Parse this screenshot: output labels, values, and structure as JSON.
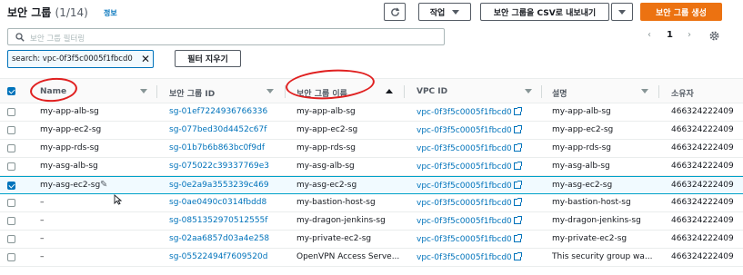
{
  "header": {
    "title": "보안 그룹",
    "count": "(1/14)",
    "info": "정보",
    "actions_label": "작업",
    "export_label": "보안 그룹을 CSV로 내보내기",
    "create_label": "보안 그룹 생성"
  },
  "search": {
    "placeholder": "보안 그룹 필터링"
  },
  "pagination": {
    "current_page": "1"
  },
  "filter": {
    "token": "search: vpc-0f3f5c0005f1fbcd0",
    "clear_label": "필터 지우기"
  },
  "table": {
    "headers": [
      "Name",
      "보안 그룹 ID",
      "보안 그룹 이름",
      "VPC ID",
      "설명",
      "소유자"
    ],
    "sorted_column": "보안 그룹 이름",
    "rows": [
      {
        "name": "my-app-alb-sg",
        "id": "sg-01ef7224936766336",
        "group_name": "my-app-alb-sg",
        "vpc": "vpc-0f3f5c0005f1fbcd0",
        "desc": "my-app-alb-sg",
        "owner": "466324222409",
        "selected": false
      },
      {
        "name": "my-app-ec2-sg",
        "id": "sg-077bed30d4452c67f",
        "group_name": "my-app-ec2-sg",
        "vpc": "vpc-0f3f5c0005f1fbcd0",
        "desc": "my-app-ec2-sg",
        "owner": "466324222409",
        "selected": false
      },
      {
        "name": "my-app-rds-sg",
        "id": "sg-01b7b6b863bc0f9df",
        "group_name": "my-app-rds-sg",
        "vpc": "vpc-0f3f5c0005f1fbcd0",
        "desc": "my-app-rds-sg",
        "owner": "466324222409",
        "selected": false
      },
      {
        "name": "my-asg-alb-sg",
        "id": "sg-075022c39337769e3",
        "group_name": "my-asg-alb-sg",
        "vpc": "vpc-0f3f5c0005f1fbcd0",
        "desc": "my-asg-alb-sg",
        "owner": "466324222409",
        "selected": false
      },
      {
        "name": "my-asg-ec2-sg",
        "id": "sg-0e2a9a3553239c469",
        "group_name": "my-asg-ec2-sg",
        "vpc": "vpc-0f3f5c0005f1fbcd0",
        "desc": "my-asg-ec2-sg",
        "owner": "466324222409",
        "selected": true
      },
      {
        "name": "–",
        "id": "sg-0ae0490c0314fbdd8",
        "group_name": "my-bastion-host-sg",
        "vpc": "vpc-0f3f5c0005f1fbcd0",
        "desc": "my-bastion-host-sg",
        "owner": "466324222409",
        "selected": false
      },
      {
        "name": "–",
        "id": "sg-0851352970512555f",
        "group_name": "my-dragon-jenkins-sg",
        "vpc": "vpc-0f3f5c0005f1fbcd0",
        "desc": "my-dragon-jenkins-sg",
        "owner": "466324222409",
        "selected": false
      },
      {
        "name": "–",
        "id": "sg-02aa6857d03a4e258",
        "group_name": "my-private-ec2-sg",
        "vpc": "vpc-0f3f5c0005f1fbcd0",
        "desc": "my-private-ec2-sg",
        "owner": "466324222409",
        "selected": false
      },
      {
        "name": "–",
        "id": "sg-05522494f7609520d",
        "group_name": "OpenVPN Access Serve...",
        "vpc": "vpc-0f3f5c0005f1fbcd0",
        "desc": "This security group wa...",
        "owner": "466324222409",
        "selected": false
      }
    ]
  },
  "colors": {
    "accent": "#ec7211",
    "link": "#0073bb",
    "annotation": "#e02020"
  }
}
